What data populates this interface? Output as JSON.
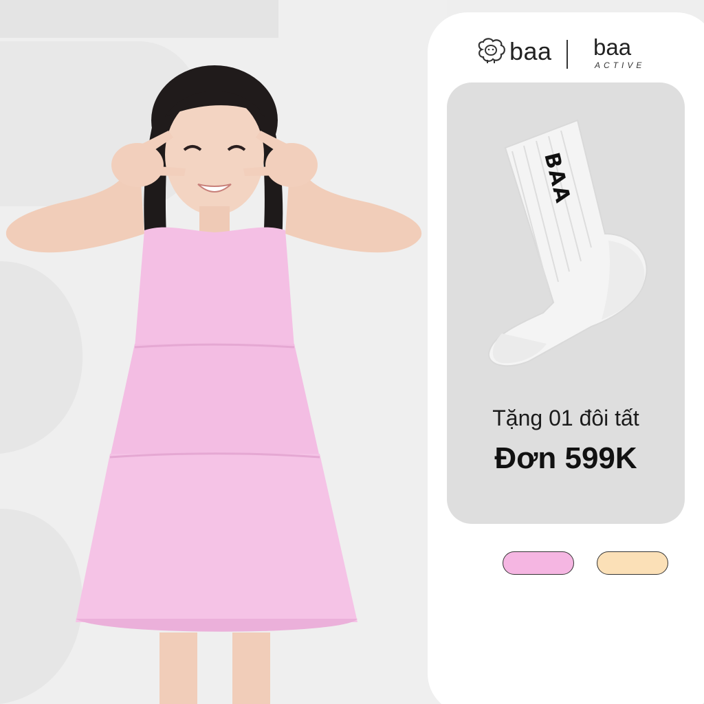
{
  "brand": {
    "logo_text": "baa",
    "sub_logo_text": "baa",
    "sub_logo_tag": "ACTIVE"
  },
  "promo": {
    "line1": "Tặng 01 đôi tất",
    "line2": "Đơn 599K"
  },
  "sock": {
    "text": "BAA"
  },
  "swatches": [
    {
      "name": "pink",
      "color": "#f5b6e2"
    },
    {
      "name": "peach",
      "color": "#fbe0b7"
    }
  ],
  "colors": {
    "background": "#eeeeee",
    "panel": "#ffffff",
    "card": "#dedede",
    "dress": "#f4bfe4"
  }
}
